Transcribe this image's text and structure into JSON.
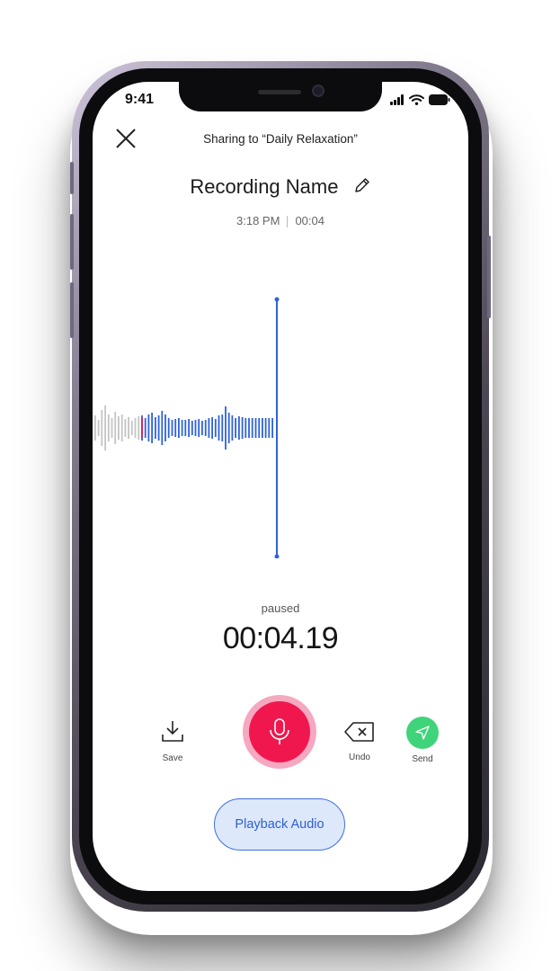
{
  "status_bar": {
    "time": "9:41"
  },
  "header": {
    "share_title": "Sharing to “Daily Relaxation”"
  },
  "recording": {
    "name": "Recording Name",
    "created_time": "3:18 PM",
    "duration": "00:04"
  },
  "recorder": {
    "state_label": "paused",
    "timer": "00:04.19"
  },
  "controls": {
    "save_label": "Save",
    "undo_label": "Undo",
    "send_label": "Send"
  },
  "playback": {
    "label": "Playback Audio"
  },
  "colors": {
    "record_accent": "#f0174f",
    "record_ring": "#f5a8bf",
    "waveform_played": "#2f62d8",
    "waveform_pending": "#c4c4c4",
    "send_accent": "#3fd47a",
    "playback_bg": "#dde8fb"
  }
}
